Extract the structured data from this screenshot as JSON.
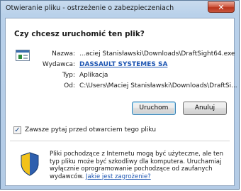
{
  "window": {
    "title": "Otwieranie pliku - ostrzeżenie o zabezpieczeniach",
    "close_glyph": "✕"
  },
  "dialog": {
    "question": "Czy chcesz uruchomić ten plik?",
    "file_icon": "executable-file-icon",
    "properties": [
      {
        "label": "Nazwa:",
        "value": "...aciej Stanisławski\\Downloads\\DraftSight64.exe"
      },
      {
        "label": "Wydawca:",
        "value": "DASSAULT SYSTEMES SA"
      },
      {
        "label": "Typ:",
        "value": "Aplikacja"
      },
      {
        "label": "Od:",
        "value": "C:\\Users\\Maciej Stanisławski\\Downloads\\DraftSi..."
      }
    ],
    "buttons": {
      "run": "Uruchom",
      "cancel": "Anuluj"
    },
    "checkbox": {
      "label": "Zawsze pytaj przed otwarciem tego pliku",
      "checked": true,
      "mark": "✓"
    },
    "warning": {
      "icon": "security-shield-icon",
      "text": "Pliki pochodzące z Internetu mogą być użyteczne, ale ten typ pliku może być szkodliwy dla komputera. Uruchamiaj wyłącznie oprogramowanie pochodzące od zaufanych wydawców.",
      "link": "Jakie jest zagrożenie?"
    }
  },
  "colors": {
    "link": "#1f57b3",
    "frame": "#b9d1ea",
    "shield_yellow": "#f2c21b",
    "shield_blue": "#2e5fae"
  }
}
